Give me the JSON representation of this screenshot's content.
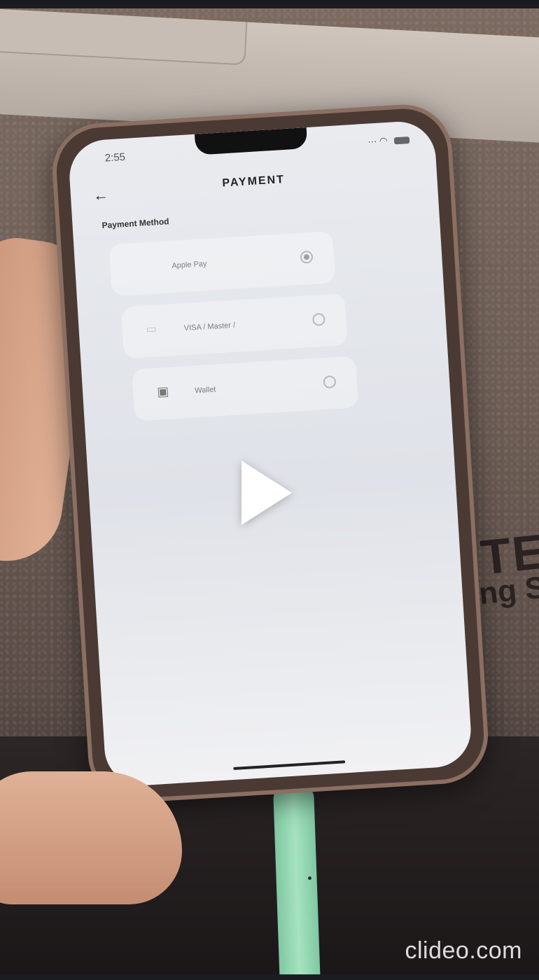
{
  "status_bar": {
    "time": "2:55"
  },
  "header": {
    "back_icon": "arrow-left-icon",
    "title": "PAYMENT"
  },
  "section": {
    "label": "Payment Method"
  },
  "payment_methods": [
    {
      "label": "Apple Pay",
      "icon": "apple-icon",
      "selected": true
    },
    {
      "label": "VISA / Master / ",
      "icon": "card-icon",
      "selected": false
    },
    {
      "label": "Wallet",
      "icon": "wallet-icon",
      "selected": false
    }
  ],
  "overlay": {
    "play_icon": "play-icon"
  },
  "watermark": {
    "text": "clideo.com"
  },
  "background_text": {
    "line1": "TE",
    "line2": "ming S"
  }
}
